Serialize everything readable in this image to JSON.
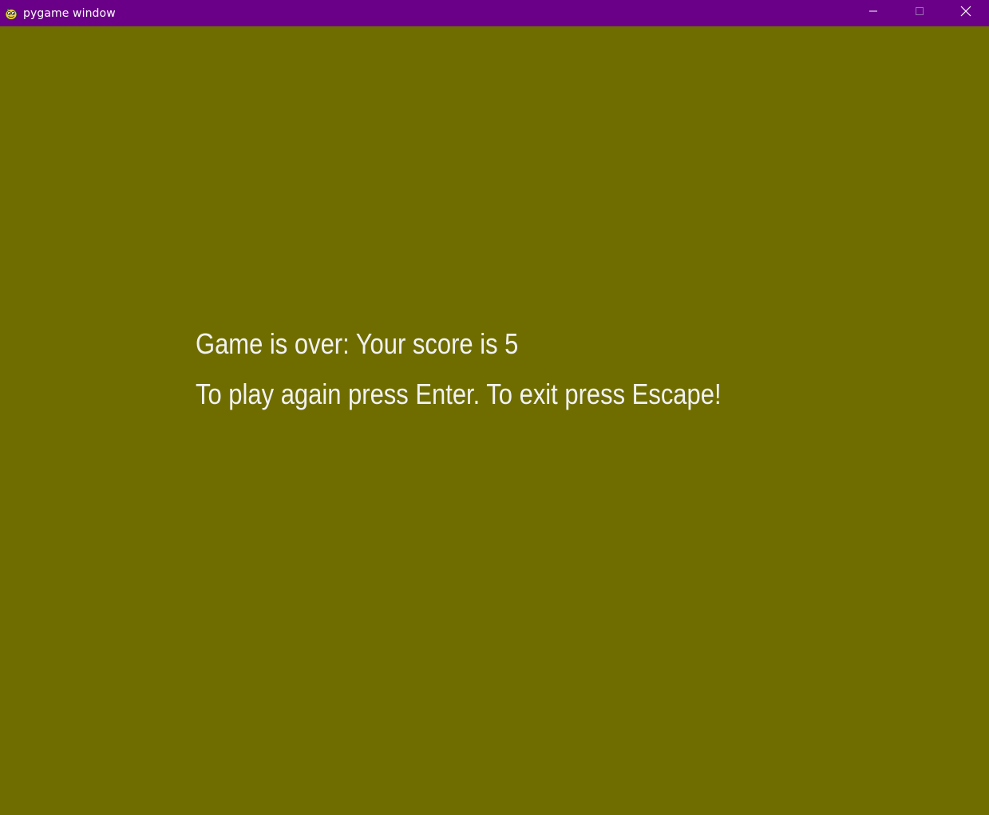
{
  "window": {
    "title": "pygame window",
    "titlebar_color": "#6a0088",
    "background_color": "#6f6d00",
    "icon": "pygame-snake-icon",
    "controls": {
      "minimize_icon": "minimize-icon",
      "maximize_icon": "maximize-icon",
      "close_icon": "close-icon"
    }
  },
  "game": {
    "game_over_text": "Game is over: Your score is 5",
    "instructions_text": "To play again press Enter. To exit press Escape!",
    "score": 5,
    "text_color": "#f2f2f2"
  }
}
